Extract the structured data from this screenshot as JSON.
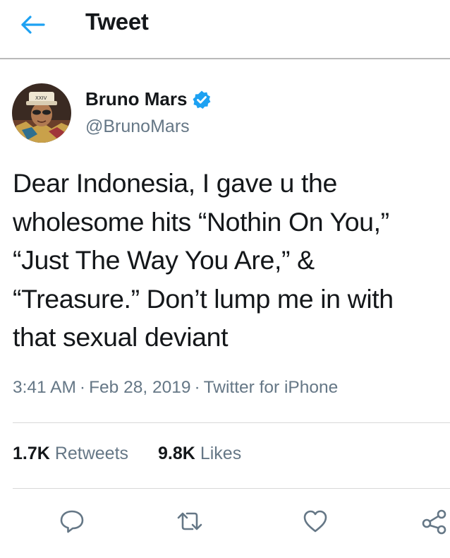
{
  "header": {
    "title": "Tweet",
    "back_icon": "arrow-left-icon"
  },
  "colors": {
    "accent": "#1da1f2",
    "text": "#14171a",
    "secondary": "#657786"
  },
  "user": {
    "display_name": "Bruno Mars",
    "handle": "@BrunoMars",
    "verified": true
  },
  "tweet": {
    "lines": [
      "Dear Indonesia, I gave u the",
      "wholesome hits “Nothin On You,”",
      "“Just The Way You Are,” &",
      "“Treasure.” Don’t lump me in with",
      "that sexual deviant"
    ],
    "time": "3:41 AM",
    "separator": "·",
    "date": "Feb 28, 2019",
    "source": "Twitter for iPhone"
  },
  "stats": {
    "retweets_count": "1.7K",
    "retweets_label": "Retweets",
    "likes_count": "9.8K",
    "likes_label": "Likes"
  },
  "actions": {
    "reply_icon": "reply-icon",
    "retweet_icon": "retweet-icon",
    "like_icon": "heart-icon",
    "share_icon": "share-icon"
  }
}
